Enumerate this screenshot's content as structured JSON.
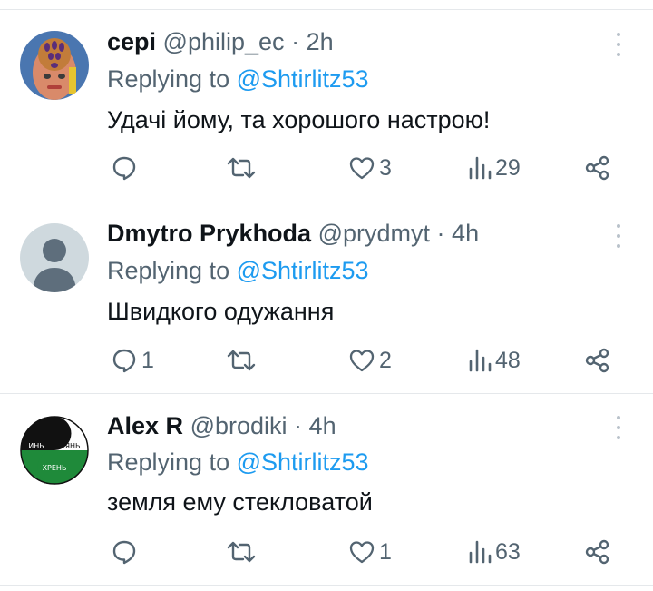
{
  "replies": [
    {
      "name": "серi",
      "handle": "@philip_ec",
      "time": "2h",
      "replying_prefix": "Replying to",
      "replying_to": "@Shtirlitz53",
      "text": "Удачі йому, та хорошого настрою!",
      "counts": {
        "replies": "",
        "reposts": "",
        "likes": "3",
        "views": "29"
      }
    },
    {
      "name": "Dmytro Prykhoda",
      "handle": "@prydmyt",
      "time": "4h",
      "replying_prefix": "Replying to",
      "replying_to": "@Shtirlitz53",
      "text": "Швидкого одужання",
      "counts": {
        "replies": "1",
        "reposts": "",
        "likes": "2",
        "views": "48"
      }
    },
    {
      "name": "Alex R",
      "handle": "@brodiki",
      "time": "4h",
      "replying_prefix": "Replying to",
      "replying_to": "@Shtirlitz53",
      "text": "земля ему стекловатой",
      "avatar_text": {
        "left": "ИНЬ",
        "right": "ЯНЬ",
        "bottom": "ХРЕНЬ"
      },
      "counts": {
        "replies": "",
        "reposts": "",
        "likes": "1",
        "views": "63"
      }
    }
  ],
  "colors": {
    "accent": "#1d9bf0",
    "secondary_text": "#536471",
    "separator": "#e5e8eb"
  }
}
